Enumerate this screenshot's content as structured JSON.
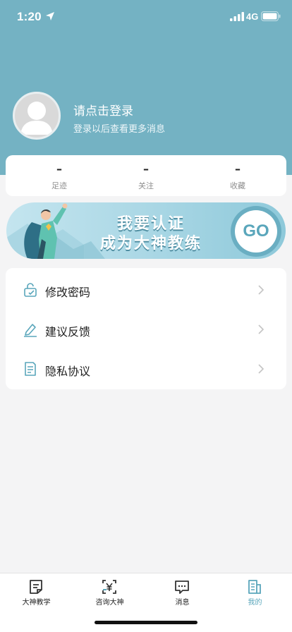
{
  "status_bar": {
    "time": "1:20",
    "network": "4G",
    "icons": [
      "location-arrow-icon",
      "signal-bars-icon",
      "battery-icon"
    ]
  },
  "profile": {
    "title": "请点击登录",
    "subtitle": "登录以后查看更多消息",
    "avatar_icon": "user-silhouette-icon"
  },
  "stats": [
    {
      "value": "–",
      "label": "足迹"
    },
    {
      "value": "–",
      "label": "关注"
    },
    {
      "value": "–",
      "label": "收藏"
    }
  ],
  "banner": {
    "line1": "我要认证",
    "line2": "成为大神教练",
    "go": "GO"
  },
  "menu": [
    {
      "label": "修改密码",
      "icon": "lock-icon"
    },
    {
      "label": "建议反馈",
      "icon": "pencil-icon"
    },
    {
      "label": "隐私协议",
      "icon": "document-icon"
    }
  ],
  "tabs": [
    {
      "label": "大神教学",
      "icon": "notes-icon",
      "active": false
    },
    {
      "label": "咨询大神",
      "icon": "yuan-scan-icon",
      "active": false
    },
    {
      "label": "消息",
      "icon": "message-icon",
      "active": false
    },
    {
      "label": "我的",
      "icon": "profile-doc-icon",
      "active": true
    }
  ],
  "colors": {
    "header": "#74b2c3",
    "accent": "#5aa6bb",
    "background": "#f4f4f5"
  }
}
